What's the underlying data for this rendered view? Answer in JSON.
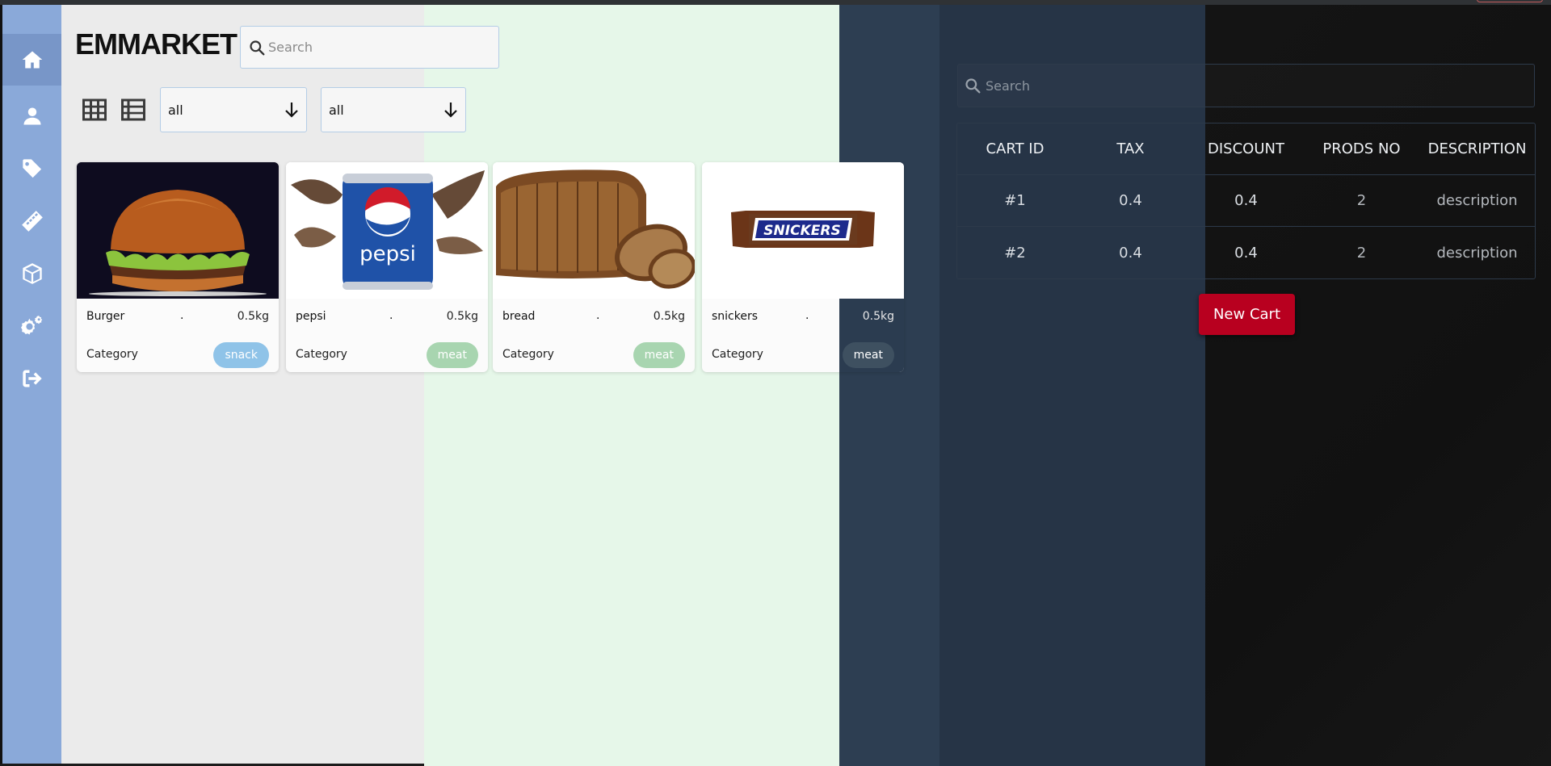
{
  "app": {
    "brand": "EMMARKET"
  },
  "sidebar": {
    "items": [
      {
        "name": "home",
        "icon": "home-icon",
        "active": true
      },
      {
        "name": "users",
        "icon": "user-icon"
      },
      {
        "name": "tags",
        "icon": "tag-icon"
      },
      {
        "name": "measure",
        "icon": "ruler-icon"
      },
      {
        "name": "products",
        "icon": "box-icon"
      },
      {
        "name": "settings",
        "icon": "gears-icon"
      },
      {
        "name": "logout",
        "icon": "logout-icon"
      }
    ]
  },
  "search": {
    "placeholder": "Search"
  },
  "filters": {
    "first": "all",
    "second": "all"
  },
  "products": [
    {
      "name": "Burger",
      "separator": ".",
      "weight": "0.5kg",
      "category_label": "Category",
      "tag": "snack",
      "tag_color": "#8fc3e8"
    },
    {
      "name": "pepsi",
      "separator": ".",
      "weight": "0.5kg",
      "category_label": "Category",
      "tag": "meat",
      "tag_color": "#a8d5b0"
    },
    {
      "name": "bread",
      "separator": ".",
      "weight": "0.5kg",
      "category_label": "Category",
      "tag": "meat",
      "tag_color": "#a8d5b0"
    },
    {
      "name": "snickers",
      "separator": ".",
      "weight": "0.5kg",
      "category_label": "Category",
      "tag": "meat",
      "tag_color": "#3e5060"
    }
  ],
  "cart": {
    "search_placeholder": "Search",
    "headers": [
      "CART ID",
      "TAX",
      "DISCOUNT",
      "PRODS NO",
      "DESCRIPTION"
    ],
    "rows": [
      [
        "#1",
        "0.4",
        "0.4",
        "2",
        "description"
      ],
      [
        "#2",
        "0.4",
        "0.4",
        "2",
        "description"
      ]
    ],
    "new_cart_label": "New Cart",
    "button_color": "#b8001f"
  }
}
